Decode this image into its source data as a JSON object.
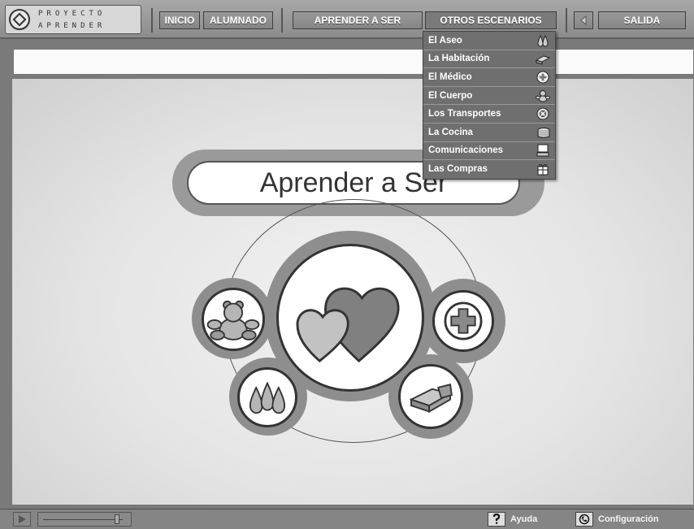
{
  "logo": {
    "line1": "PROYECTO",
    "line2": "APRENDER"
  },
  "nav": {
    "inicio": "INICIO",
    "alumnado": "ALUMNADO",
    "aprender": "APRENDER A SER",
    "otros": "OTROS ESCENARIOS",
    "salida": "SALIDA"
  },
  "main": {
    "title": "Aprender a Ser"
  },
  "menu": {
    "items": [
      {
        "label": "El Aseo",
        "icon": "water-drops-icon"
      },
      {
        "label": "La Habitación",
        "icon": "bed-icon"
      },
      {
        "label": "El Médico",
        "icon": "medical-cross-icon"
      },
      {
        "label": "El Cuerpo",
        "icon": "teddy-bear-icon"
      },
      {
        "label": "Los Transportes",
        "icon": "wheel-icon"
      },
      {
        "label": "La Cocina",
        "icon": "cooking-pot-icon"
      },
      {
        "label": "Comunicaciones",
        "icon": "computer-icon"
      },
      {
        "label": "Las Compras",
        "icon": "gift-icon"
      }
    ]
  },
  "bottom": {
    "help": "Ayuda",
    "config": "Configuración"
  }
}
